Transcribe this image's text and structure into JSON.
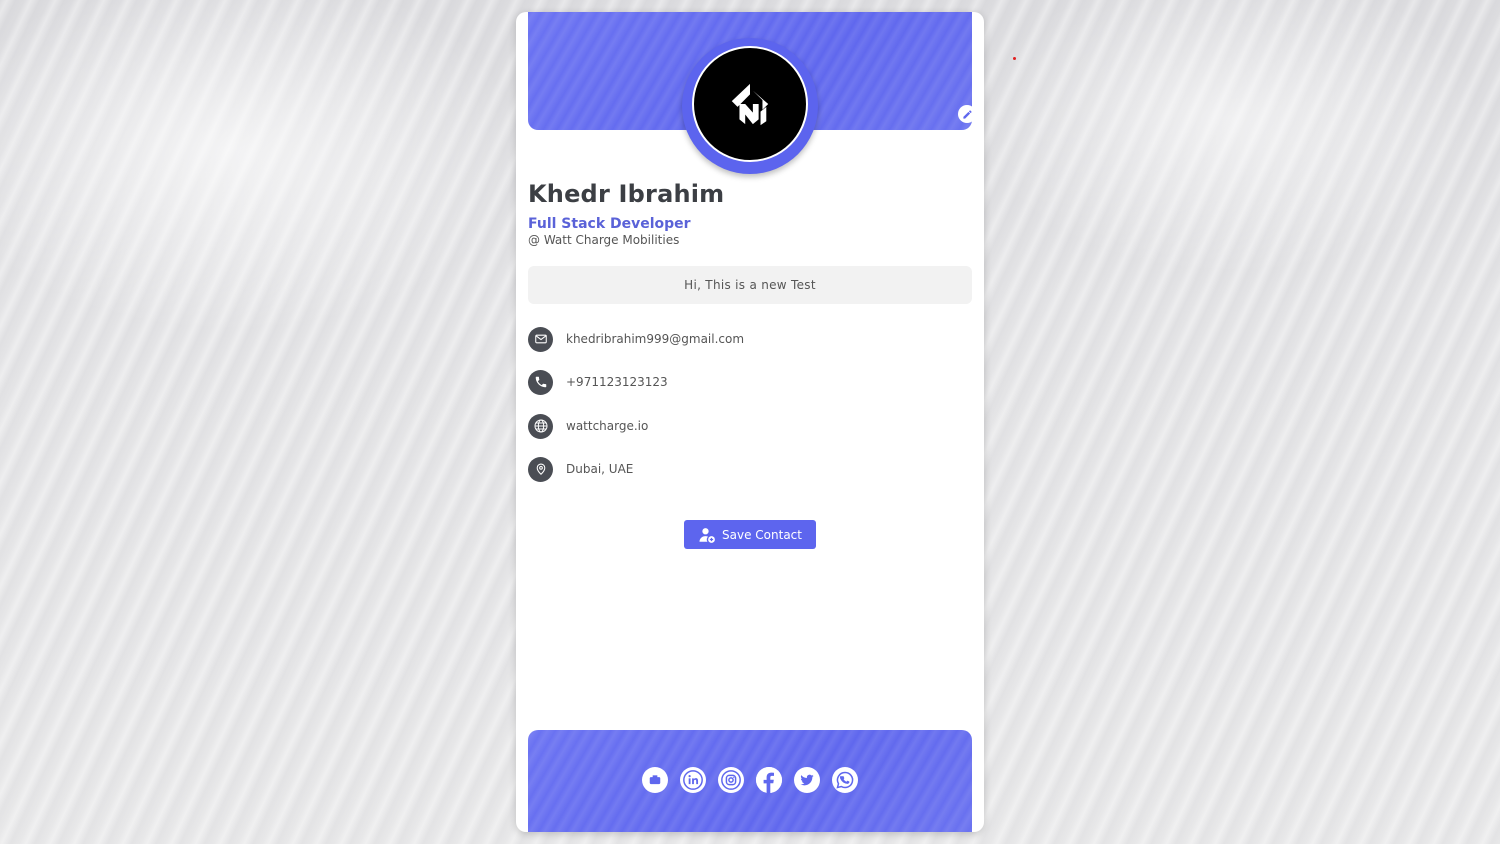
{
  "profile": {
    "name": "Khedr Ibrahim",
    "title": "Full Stack Developer",
    "company": "@ Watt Charge Mobilities",
    "bio": "Hi, This is a new Test"
  },
  "contacts": [
    {
      "type": "email",
      "icon": "mail-icon",
      "value": "khedribrahim999@gmail.com"
    },
    {
      "type": "phone",
      "icon": "phone-icon",
      "value": "+971123123123"
    },
    {
      "type": "website",
      "icon": "globe-icon",
      "value": "wattcharge.io"
    },
    {
      "type": "location",
      "icon": "location-pin-icon",
      "value": "Dubai, UAE"
    }
  ],
  "actions": {
    "save_contact_label": "Save Contact"
  },
  "social": [
    {
      "name": "portfolio",
      "icon": "briefcase-icon"
    },
    {
      "name": "linkedin",
      "icon": "linkedin-icon"
    },
    {
      "name": "instagram",
      "icon": "instagram-icon"
    },
    {
      "name": "facebook",
      "icon": "facebook-icon"
    },
    {
      "name": "twitter",
      "icon": "twitter-icon"
    },
    {
      "name": "whatsapp",
      "icon": "whatsapp-icon"
    }
  ],
  "colors": {
    "accent": "#5f67ee",
    "icon_dark": "#4a4d54",
    "name_text": "#3c3f44",
    "title_text": "#5a62d8"
  }
}
